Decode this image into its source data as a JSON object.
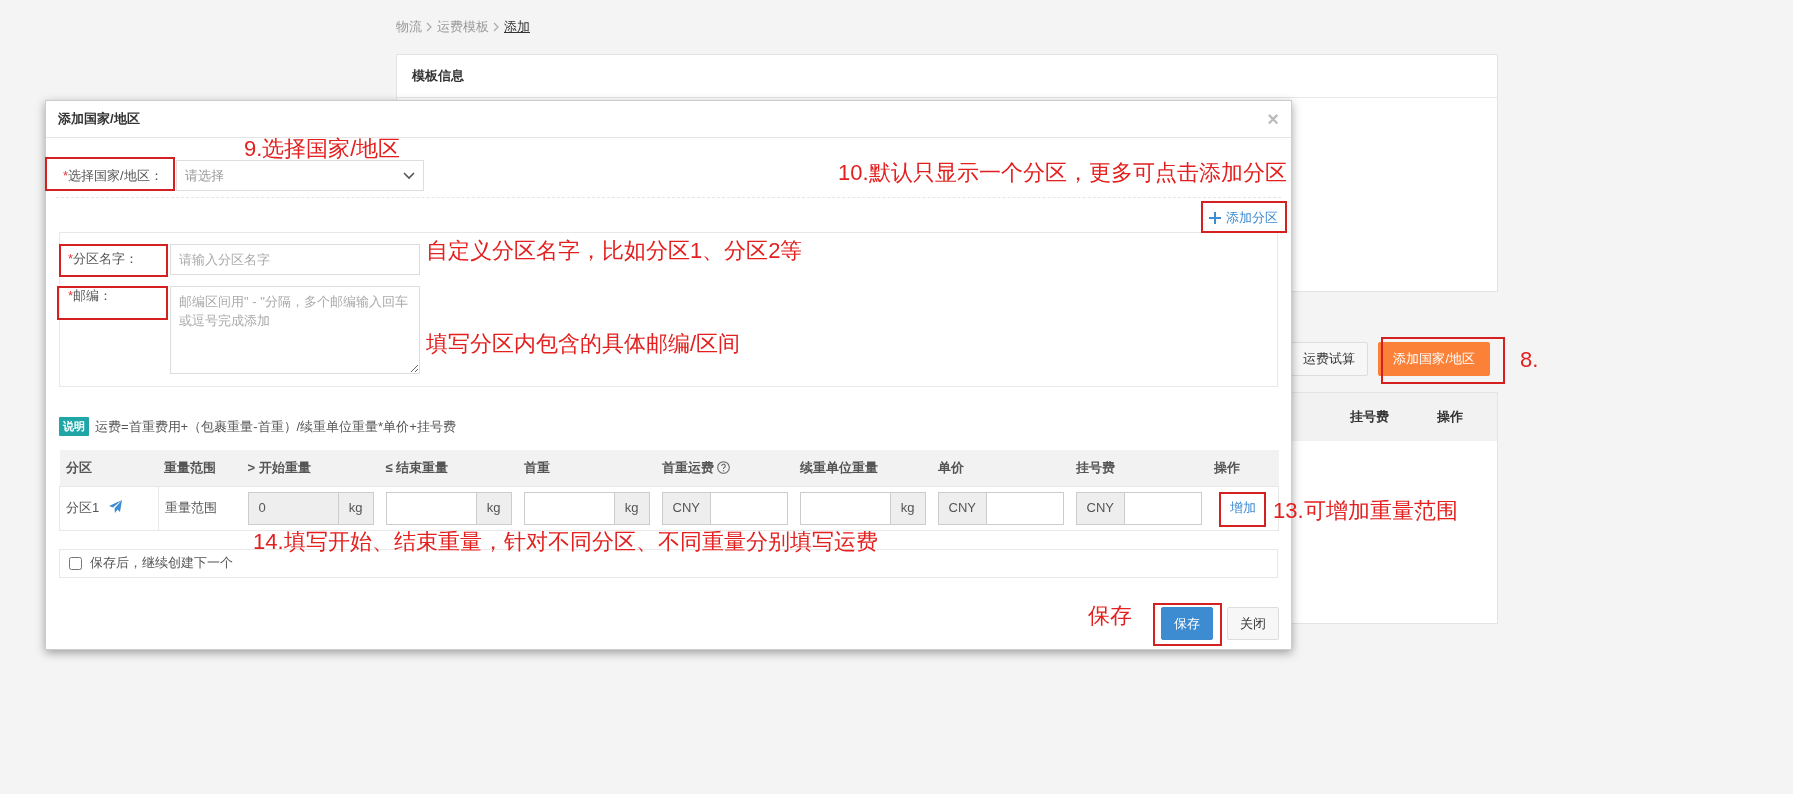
{
  "breadcrumb": [
    {
      "label": "物流"
    },
    {
      "label": "运费模板"
    },
    {
      "label": "添加"
    }
  ],
  "template_panel": {
    "title": "模板信息"
  },
  "toolbar": {
    "buttons": [
      {
        "label": "运费试算",
        "kind": "default"
      },
      {
        "label": "添加国家/地区",
        "kind": "primary"
      }
    ]
  },
  "background_table": {
    "columns": [
      "挂号费",
      "操作"
    ]
  },
  "dialog": {
    "title": "添加国家/地区",
    "close": "×",
    "country": {
      "required_mark": "*",
      "label": "选择国家/地区：",
      "placeholder": "请选择"
    },
    "add_zone": "添加分区",
    "zone_name": {
      "required_mark": "*",
      "label": "分区名字：",
      "placeholder": "请输入分区名字"
    },
    "postcode": {
      "required_mark": "*",
      "label": "邮编：",
      "placeholder": "邮编区间用\" - \"分隔，多个邮编输入回车或逗号完成添加"
    },
    "note": {
      "badge": "说明",
      "text": "运费=首重费用+（包裹重量-首重）/续重单位重量*单价+挂号费"
    },
    "table": {
      "columns": [
        {
          "label": "分区",
          "help": false
        },
        {
          "label": "重量范围",
          "help": false
        },
        {
          "label": "> 开始重量",
          "help": false
        },
        {
          "label": "≤ 结束重量",
          "help": false
        },
        {
          "label": "首重",
          "help": false
        },
        {
          "label": "首重运费",
          "help": true
        },
        {
          "label": "续重单位重量",
          "help": false
        },
        {
          "label": "单价",
          "help": false
        },
        {
          "label": "挂号费",
          "help": false
        },
        {
          "label": "操作",
          "help": false
        }
      ],
      "rows": [
        {
          "cells": [
            {
              "kind": "zone",
              "text": "分区1"
            },
            {
              "kind": "text",
              "text": "重量范围"
            },
            {
              "kind": "suffix",
              "addon": "kg",
              "value": "0",
              "disabled": true
            },
            {
              "kind": "suffix",
              "addon": "kg",
              "disabled": false
            },
            {
              "kind": "suffix",
              "addon": "kg",
              "disabled": false
            },
            {
              "kind": "prefix",
              "addon": "CNY",
              "disabled": false
            },
            {
              "kind": "suffix",
              "addon": "kg",
              "disabled": false
            },
            {
              "kind": "prefix",
              "addon": "CNY",
              "disabled": false
            },
            {
              "kind": "prefix",
              "addon": "CNY",
              "disabled": false
            },
            {
              "kind": "link",
              "text": "增加"
            }
          ]
        }
      ]
    },
    "continue": {
      "label": "保存后，继续创建下一个",
      "checked": false
    },
    "buttons": [
      {
        "label": "保存",
        "kind": "primary"
      },
      {
        "label": "关闭",
        "kind": "default"
      }
    ]
  },
  "annotations": [
    {
      "text": "9.选择国家/地区"
    },
    {
      "text": "10.默认只显示一个分区，更多可点击添加分区"
    },
    {
      "text": "自定义分区名字，比如分区1、分区2等"
    },
    {
      "text": "填写分区内包含的具体邮编/区间"
    },
    {
      "text": "8."
    },
    {
      "text": "13.可增加重量范围"
    },
    {
      "text": "14.填写开始、结束重量，针对不同分区、不同重量分别填写运费"
    },
    {
      "text": "保存"
    }
  ]
}
